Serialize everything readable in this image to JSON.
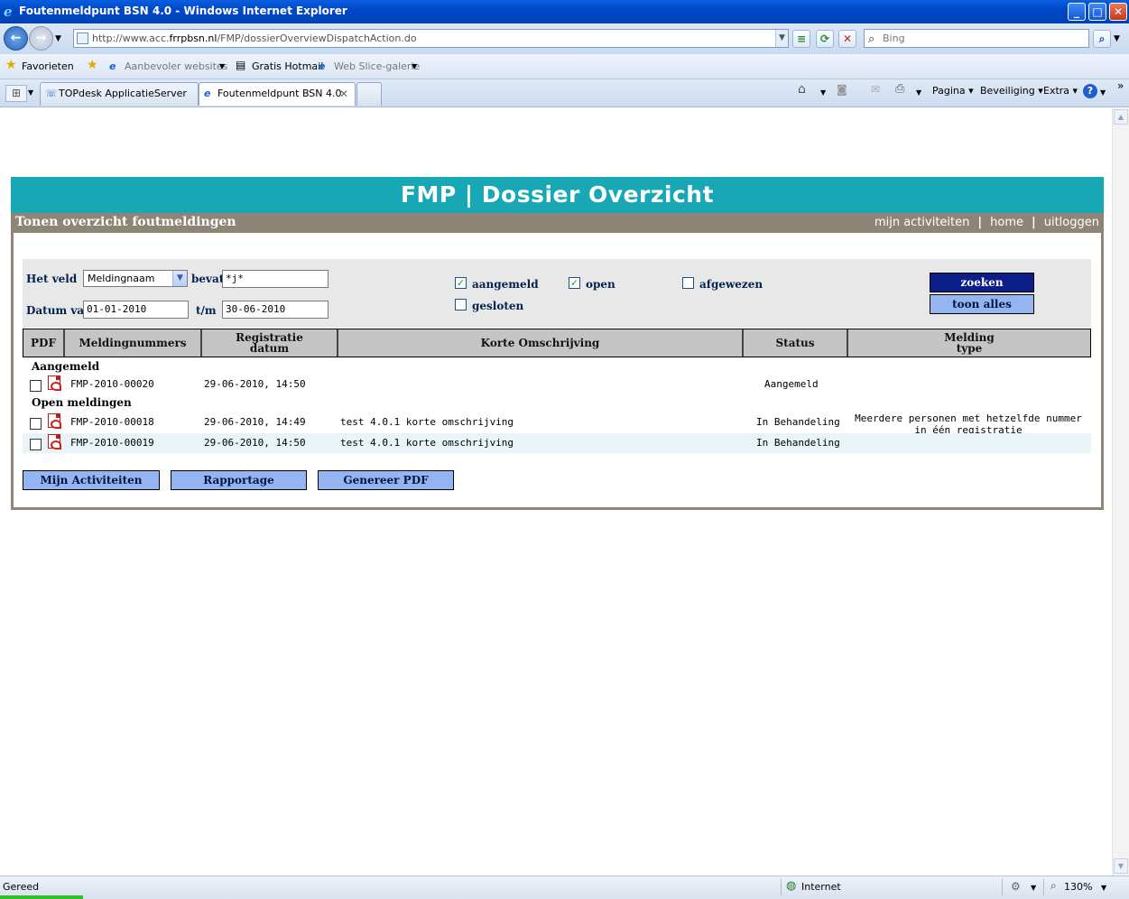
{
  "window": {
    "title": "Foutenmeldpunt BSN 4.0 - Windows Internet Explorer",
    "buttons": [
      "_",
      "□",
      "✕"
    ]
  },
  "address": {
    "url_prefix": "http://www.acc.",
    "url_domain": "frrpbsn.nl",
    "url_path": "/FMP/dossierOverviewDispatchAction.do",
    "search_placeholder": "Bing"
  },
  "favorites": {
    "label": "Favorieten",
    "items": [
      "Aanbevoler websites",
      "Gratis Hotmail",
      "Web Slice-galerie"
    ]
  },
  "tabs": {
    "items": [
      "TOPdesk ApplicatieServer",
      "Foutenmeldpunt BSN 4.0"
    ],
    "commands": [
      "Pagina",
      "Beveiliging",
      "Extra"
    ]
  },
  "app": {
    "header": "FMP | Dossier Overzicht",
    "subheader": "Tonen overzicht foutmeldingen",
    "links": [
      "mijn activiteiten",
      "home",
      "uitloggen"
    ]
  },
  "filter": {
    "field_label": "Het veld",
    "field_value": "Meldingnaam",
    "contains_label": "bevat",
    "contains_value": "*j*",
    "date_from_label": "Datum van",
    "date_from_value": "01-01-2010",
    "date_to_label": "t/m",
    "date_to_value": "30-06-2010",
    "checkboxes": [
      {
        "label": "aangemeld",
        "checked": true
      },
      {
        "label": "open",
        "checked": true
      },
      {
        "label": "afgewezen",
        "checked": false
      },
      {
        "label": "gesloten",
        "checked": false
      }
    ],
    "search_button": "zoeken",
    "show_all_button": "toon alles"
  },
  "table": {
    "headers": [
      "PDF",
      "Meldingnummers",
      "Registratie datum",
      "Korte Omschrijving",
      "Status",
      "Melding type"
    ],
    "groups": [
      {
        "title": "Aangemeld",
        "rows": [
          {
            "number": "FMP-2010-00020",
            "date": "29-06-2010, 14:50",
            "description": "",
            "status": "Aangemeld",
            "type": ""
          }
        ]
      },
      {
        "title": "Open meldingen",
        "rows": [
          {
            "number": "FMP-2010-00018",
            "date": "29-06-2010, 14:49",
            "description": "test 4.0.1 korte omschrijving",
            "status": "In Behandeling",
            "type": "Meerdere personen met hetzelfde nummer in één registratie"
          },
          {
            "number": "FMP-2010-00019",
            "date": "29-06-2010, 14:50",
            "description": "test 4.0.1 korte omschrijving",
            "status": "In Behandeling",
            "type": ""
          }
        ]
      }
    ]
  },
  "footer_buttons": [
    "Mijn Activiteiten",
    "Rapportage",
    "Genereer PDF"
  ],
  "statusbar": {
    "left": "Gereed",
    "zone": "Internet",
    "zoom": "130%"
  }
}
